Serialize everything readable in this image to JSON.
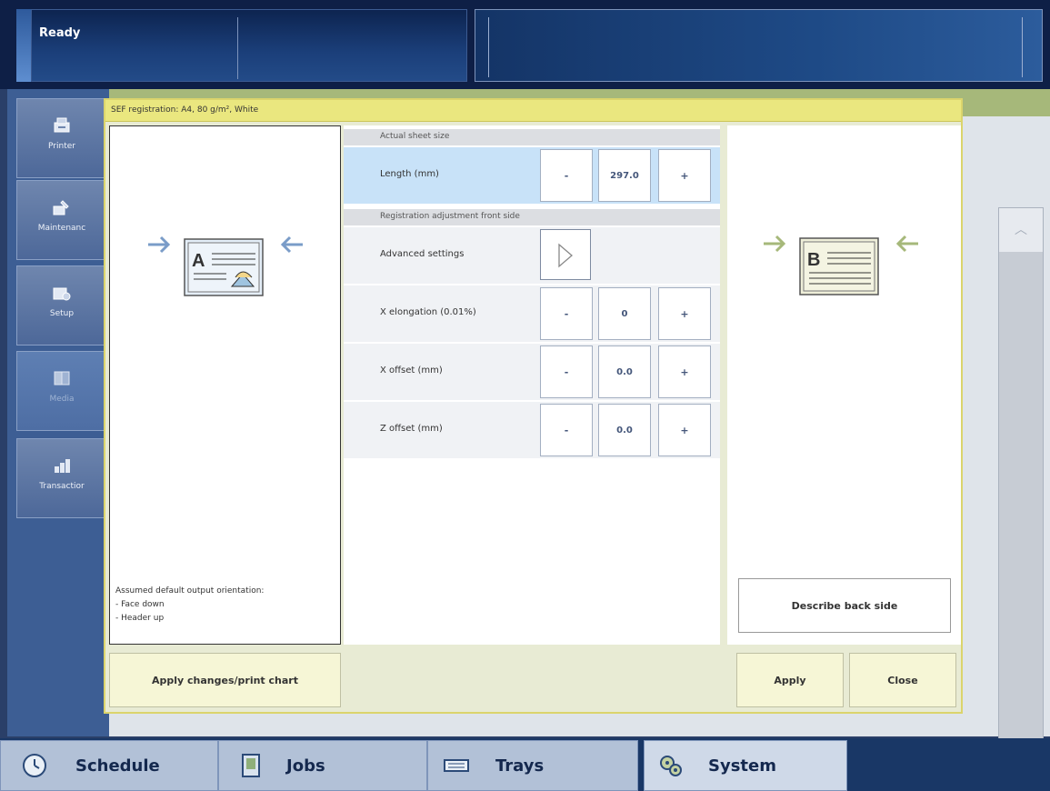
{
  "status": {
    "state": "Ready"
  },
  "nav": {
    "items": [
      {
        "label": "Printer",
        "icon": "printer-icon"
      },
      {
        "label": "Maintenanc",
        "icon": "maintenance-icon"
      },
      {
        "label": "Setup",
        "icon": "setup-icon"
      },
      {
        "label": "Media",
        "icon": "media-icon",
        "active": true
      },
      {
        "label": "Transactior",
        "icon": "transaction-icon"
      }
    ]
  },
  "dialog": {
    "title": "SEF registration: A4, 80 g/m², White",
    "front_diagram_letter": "A",
    "back_diagram_letter": "B",
    "orientation": {
      "heading": "Assumed default output orientation:",
      "line1": "- Face down",
      "line2": "- Header up"
    },
    "sections": {
      "actual_sheet_size": "Actual sheet size",
      "registration_front": "Registration adjustment front side"
    },
    "rows": {
      "length": {
        "label": "Length (mm)",
        "minus": "-",
        "value": "297.0",
        "plus": "+"
      },
      "advanced": {
        "label": "Advanced settings"
      },
      "x_elongation": {
        "label": "X elongation (0.01%)",
        "minus": "-",
        "value": "0",
        "plus": "+"
      },
      "x_offset": {
        "label": "X offset (mm)",
        "minus": "-",
        "value": "0.0",
        "plus": "+"
      },
      "z_offset": {
        "label": "Z offset (mm)",
        "minus": "-",
        "value": "0.0",
        "plus": "+"
      }
    },
    "buttons": {
      "describe_back": "Describe back side",
      "apply_changes": "Apply changes/print chart",
      "apply": "Apply",
      "close": "Close"
    }
  },
  "tabs": [
    {
      "label": "Schedule",
      "icon": "clock-icon"
    },
    {
      "label": "Jobs",
      "icon": "document-icon"
    },
    {
      "label": "Trays",
      "icon": "tray-icon"
    },
    {
      "label": "System",
      "icon": "gears-icon",
      "active": true
    }
  ],
  "colors": {
    "dialog_title_bg": "#eae77f",
    "highlight_row": "#c8e2f8",
    "arrow_blue": "#7a9cc8",
    "arrow_green": "#a6b87a"
  }
}
